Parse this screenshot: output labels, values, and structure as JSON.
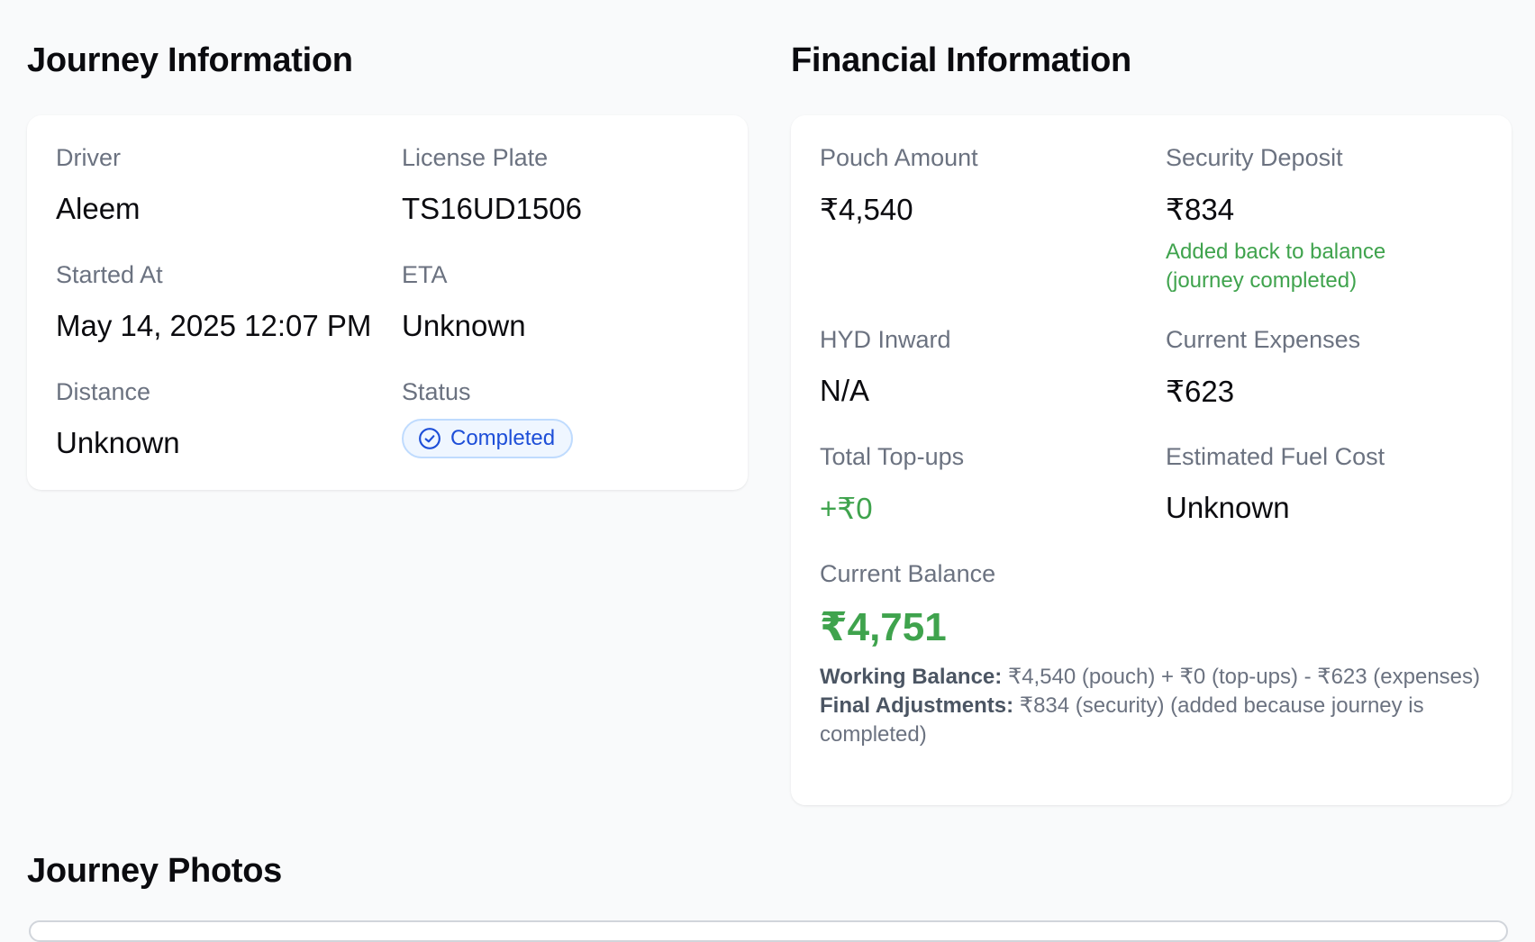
{
  "journey": {
    "title": "Journey Information",
    "driver": {
      "label": "Driver",
      "value": "Aleem"
    },
    "license_plate": {
      "label": "License Plate",
      "value": "TS16UD1506"
    },
    "started_at": {
      "label": "Started At",
      "value": "May 14, 2025 12:07 PM"
    },
    "eta": {
      "label": "ETA",
      "value": "Unknown"
    },
    "distance": {
      "label": "Distance",
      "value": "Unknown"
    },
    "status": {
      "label": "Status",
      "value": "Completed",
      "icon": "check-circle-icon"
    }
  },
  "financial": {
    "title": "Financial Information",
    "pouch_amount": {
      "label": "Pouch Amount",
      "value": "₹4,540"
    },
    "security_deposit": {
      "label": "Security Deposit",
      "value": "₹834",
      "note_line1": "Added back to balance",
      "note_line2": "(journey completed)"
    },
    "hyd_inward": {
      "label": "HYD Inward",
      "value": "N/A"
    },
    "current_expenses": {
      "label": "Current Expenses",
      "value": "₹623"
    },
    "total_topups": {
      "label": "Total Top-ups",
      "value": "+₹0"
    },
    "fuel_cost": {
      "label": "Estimated Fuel Cost",
      "value": "Unknown"
    },
    "current_balance": {
      "label": "Current Balance",
      "value": "₹4,751"
    },
    "working_balance": {
      "label": "Working Balance:",
      "text": "₹4,540 (pouch) + ₹0 (top-ups) - ₹623 (expenses)"
    },
    "final_adjustments": {
      "label": "Final Adjustments:",
      "text": "₹834 (security) (added because journey is completed)"
    }
  },
  "photos": {
    "title": "Journey Photos"
  },
  "colors": {
    "positive": "#3fa34d",
    "badge_blue": "#1d4ed8",
    "label_gray": "#6b7280"
  }
}
